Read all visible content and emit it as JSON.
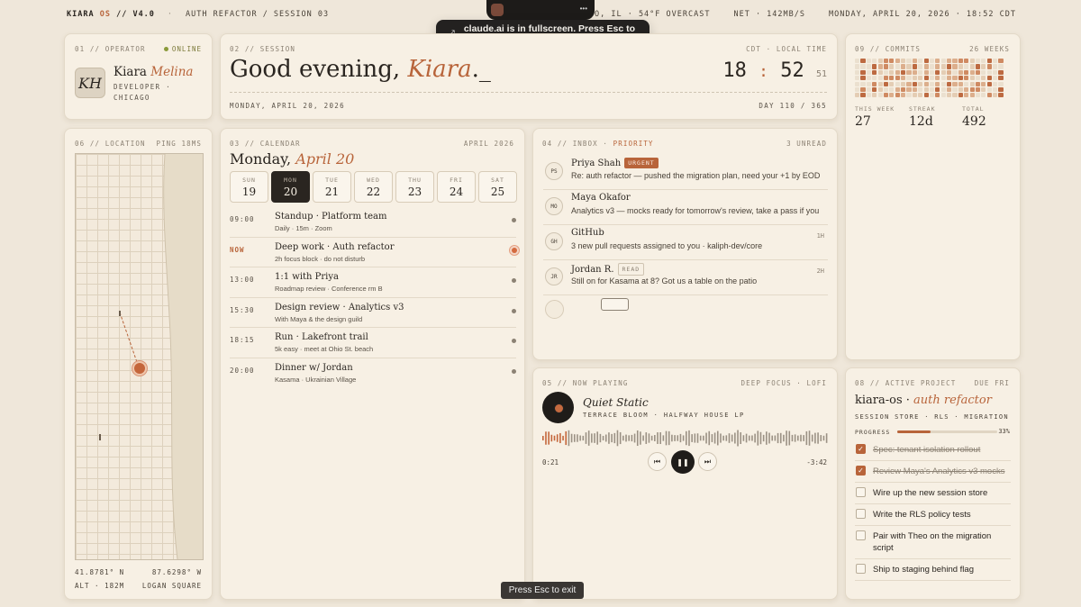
{
  "topbar": {
    "brand": "KIARA",
    "brand_os": "OS",
    "version": "// V4.0",
    "session": "AUTH REFACTOR / SESSION 03",
    "weather": "CHICAGO, IL · 54°F OVERCAST",
    "net": "NET · 142MB/S",
    "datetime": "MONDAY, APRIL 20, 2026 · 18:52 CDT"
  },
  "toast": {
    "text": "claude.ai is in fullscreen. Press Esc to exit."
  },
  "esc_pill": "Press Esc to exit",
  "operator": {
    "label": "01 // OPERATOR",
    "status": "ONLINE",
    "initials": "KH",
    "first": "Kiara",
    "last": "Melina",
    "role": "DEVELOPER · CHICAGO"
  },
  "session": {
    "label": "02 // SESSION",
    "time_label": "CDT · LOCAL TIME",
    "greeting": "Good evening,",
    "name": "Kiara",
    "cursor": "._",
    "hours": "18",
    "colon": ":",
    "minutes": "52",
    "seconds": "51",
    "date": "MONDAY, APRIL 20, 2026",
    "day_of_year": "DAY 110 / 365"
  },
  "commits": {
    "label": "09 // COMMITS",
    "range": "26 WEEKS",
    "stats": [
      {
        "label": "THIS WEEK",
        "value": "27"
      },
      {
        "label": "STREAK",
        "value": "12d"
      },
      {
        "label": "TOTAL",
        "value": "492"
      }
    ]
  },
  "location": {
    "label": "06 // LOCATION",
    "ping": "PING 18MS",
    "lat": "41.8781° N",
    "lon": "87.6298° W",
    "alt": "ALT · 182M",
    "neighborhood": "LOGAN SQUARE"
  },
  "calendar": {
    "label": "03 // CALENDAR",
    "month": "APRIL 2026",
    "title_day": "Monday,",
    "title_date": "April 20",
    "days": [
      {
        "name": "SUN",
        "num": "19"
      },
      {
        "name": "MON",
        "num": "20"
      },
      {
        "name": "TUE",
        "num": "21"
      },
      {
        "name": "WED",
        "num": "22"
      },
      {
        "name": "THU",
        "num": "23"
      },
      {
        "name": "FRI",
        "num": "24"
      },
      {
        "name": "SAT",
        "num": "25"
      }
    ],
    "events": [
      {
        "time": "09:00",
        "title": "Standup · Platform team",
        "sub": "Daily · 15m · Zoom"
      },
      {
        "time": "NOW",
        "title": "Deep work · Auth refactor",
        "sub": "2h focus block · do not disturb"
      },
      {
        "time": "13:00",
        "title": "1:1 with Priya",
        "sub": "Roadmap review · Conference rm B"
      },
      {
        "time": "15:30",
        "title": "Design review · Analytics v3",
        "sub": "With Maya & the design guild"
      },
      {
        "time": "18:15",
        "title": "Run · Lakefront trail",
        "sub": "5k easy · meet at Ohio St. beach"
      },
      {
        "time": "20:00",
        "title": "Dinner w/ Jordan",
        "sub": "Kasama · Ukrainian Village"
      }
    ]
  },
  "inbox": {
    "label": "04 // INBOX ·",
    "filter": "PRIORITY",
    "unread": "3 UNREAD",
    "messages": [
      {
        "initials": "PS",
        "from": "Priya Shah",
        "tag": "URGENT",
        "preview": "Re: auth refactor — pushed the migration plan, need your +1 by EOD",
        "when": ""
      },
      {
        "initials": "MO",
        "from": "Maya Okafor",
        "tag": "",
        "preview": "Analytics v3 — mocks ready for tomorrow's review, take a pass if you",
        "when": ""
      },
      {
        "initials": "GH",
        "from": "GitHub",
        "tag": "",
        "preview": "3 new pull requests assigned to you · kaliph-dev/core",
        "when": "1H"
      },
      {
        "initials": "JR",
        "from": "Jordan R.",
        "tag": "READ",
        "preview": "Still on for Kasama at 8? Got us a table on the patio",
        "when": "2H"
      }
    ]
  },
  "player": {
    "label": "05 // NOW PLAYING",
    "mode": "DEEP FOCUS · LOFI",
    "song": "Quiet Static",
    "artist": "TERRACE BLOOM · HALFWAY HOUSE LP",
    "elapsed": "0:21",
    "remaining": "-3:42",
    "progress": 0.09
  },
  "project": {
    "label": "08 // ACTIVE PROJECT",
    "due": "DUE FRI",
    "name": "kiara-os ·",
    "name_it": "auth refactor",
    "tags": "SESSION STORE · RLS · MIGRATION",
    "progress_label": "PROGRESS",
    "progress_value": 33,
    "progress_pct": "33%",
    "tasks": [
      {
        "text": "Spec: tenant isolation rollout",
        "done": true
      },
      {
        "text": "Review Maya's Analytics v3 mocks",
        "done": true
      },
      {
        "text": "Wire up the new session store",
        "done": false
      },
      {
        "text": "Write the RLS policy tests",
        "done": false
      },
      {
        "text": "Pair with Theo on the migration script",
        "done": false
      },
      {
        "text": "Ship to staging behind flag",
        "done": false
      }
    ]
  },
  "colors": {
    "accent": "#b8643a",
    "bg": "#efe7da",
    "card": "#f7f0e4"
  }
}
